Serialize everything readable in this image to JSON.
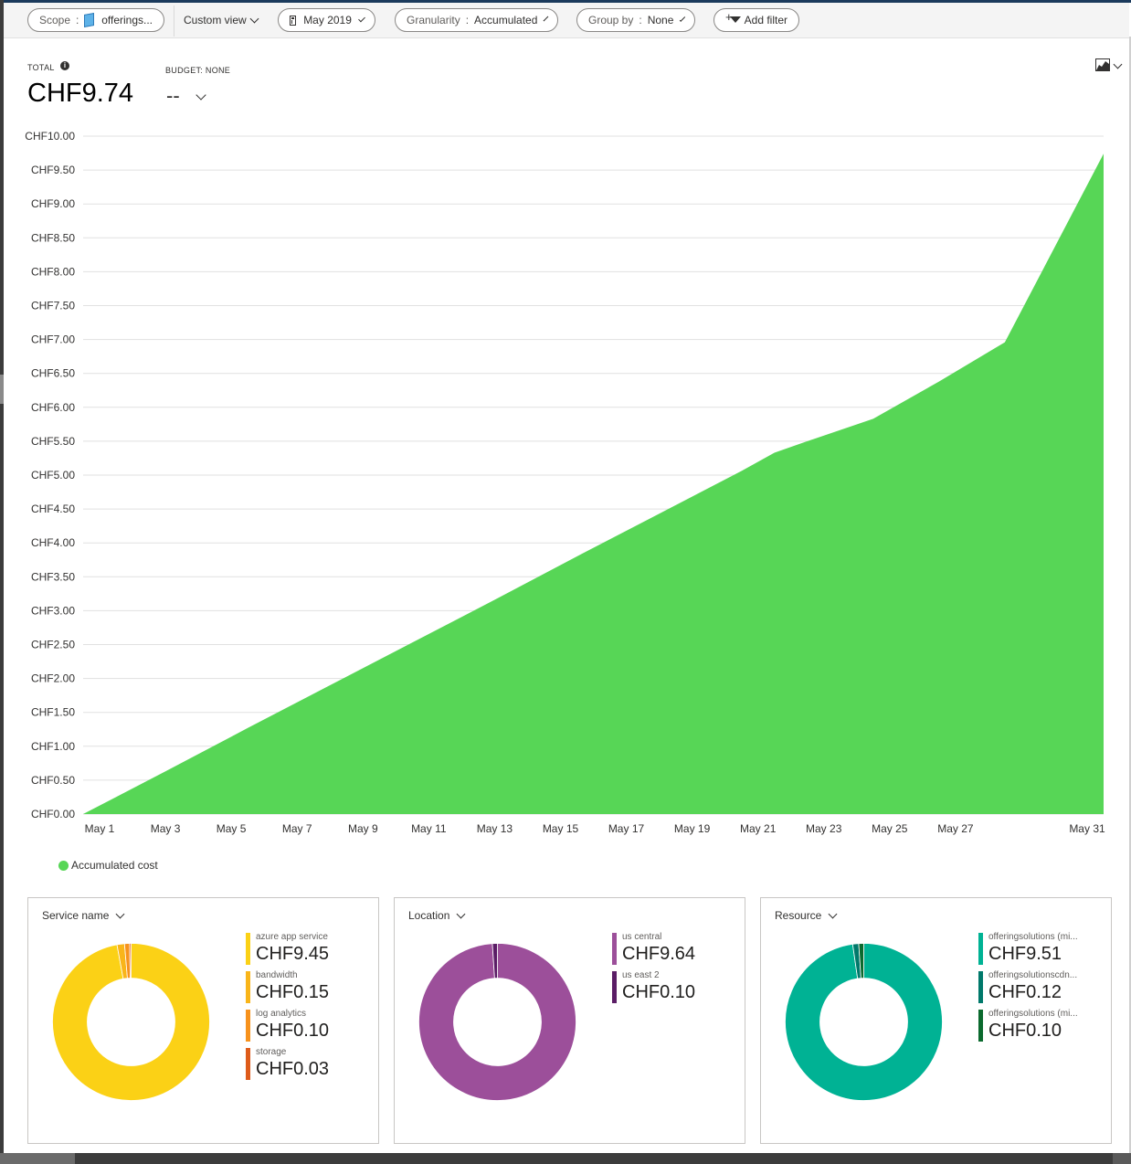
{
  "toolbar": {
    "scope_key": "Scope",
    "scope_sep": ":",
    "scope_value": "offerings...",
    "custom_view": "Custom view",
    "date_range": "May 2019",
    "granularity_key": "Granularity",
    "granularity_sep": ":",
    "granularity_value": "Accumulated",
    "groupby_key": "Group by",
    "groupby_sep": ":",
    "groupby_value": "None",
    "add_filter": "Add filter"
  },
  "summary": {
    "total_label": "TOTAL",
    "total_value": "CHF9.74",
    "budget_label": "BUDGET: NONE",
    "budget_value": "--"
  },
  "colors": {
    "accumulated": "#57d656",
    "service": [
      "#fbd116",
      "#f9b51a",
      "#f7921c",
      "#de5b1a"
    ],
    "location": [
      "#9c4f9a",
      "#5b1d66"
    ],
    "resource": [
      "#00b294",
      "#00796b",
      "#0b6a2e"
    ]
  },
  "chart_data": [
    {
      "type": "area",
      "title": "",
      "xlabel": "",
      "ylabel": "",
      "x_tick_labels": [
        "May 1",
        "May 3",
        "May 5",
        "May 7",
        "May 9",
        "May 11",
        "May 13",
        "May 15",
        "May 17",
        "May 19",
        "May 21",
        "May 23",
        "May 25",
        "May 27",
        "May 31"
      ],
      "y_tick_labels": [
        "CHF0.00",
        "CHF0.50",
        "CHF1.00",
        "CHF1.50",
        "CHF2.00",
        "CHF2.50",
        "CHF3.00",
        "CHF3.50",
        "CHF4.00",
        "CHF4.50",
        "CHF5.00",
        "CHF5.50",
        "CHF6.00",
        "CHF6.50",
        "CHF7.00",
        "CHF7.50",
        "CHF8.00",
        "CHF8.50",
        "CHF9.00",
        "CHF9.50",
        "CHF10.00"
      ],
      "ylim": [
        0,
        10
      ],
      "grid": true,
      "legend": "bottom-left",
      "series": [
        {
          "name": "Accumulated cost",
          "x": [
            0,
            2.5,
            5,
            7.5,
            10,
            12.5,
            15,
            17.5,
            20,
            21,
            22,
            24,
            26,
            28,
            31
          ],
          "values": [
            0.0,
            0.63,
            1.27,
            1.9,
            2.53,
            3.16,
            3.8,
            4.43,
            5.06,
            5.33,
            5.5,
            5.83,
            6.38,
            6.96,
            9.74
          ]
        }
      ]
    },
    {
      "type": "pie",
      "title": "Service name",
      "labels": [
        "azure app service",
        "bandwidth",
        "log analytics",
        "storage"
      ],
      "value_labels": [
        "CHF9.45",
        "CHF0.15",
        "CHF0.10",
        "CHF0.03"
      ],
      "values": [
        9.45,
        0.15,
        0.1,
        0.03
      ]
    },
    {
      "type": "pie",
      "title": "Location",
      "labels": [
        "us central",
        "us east 2"
      ],
      "value_labels": [
        "CHF9.64",
        "CHF0.10"
      ],
      "values": [
        9.64,
        0.1
      ]
    },
    {
      "type": "pie",
      "title": "Resource",
      "labels": [
        "offeringsolutions (mi...",
        "offeringsolutionscdn...",
        "offeringsolutions (mi..."
      ],
      "value_labels": [
        "CHF9.51",
        "CHF0.12",
        "CHF0.10"
      ],
      "values": [
        9.51,
        0.12,
        0.1
      ]
    }
  ]
}
